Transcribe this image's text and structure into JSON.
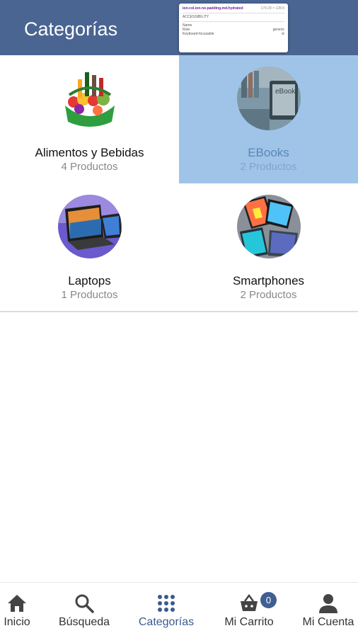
{
  "header": {
    "title": "Categorías"
  },
  "inspector_tooltip": {
    "selector": "ion-col.ion-no-padding.md.hydrated",
    "size": "179.29 × 128.5",
    "section": "ACCESSIBILITY",
    "rows": [
      {
        "label": "Name",
        "value": ""
      },
      {
        "label": "Role",
        "value": "generic"
      },
      {
        "label": "Keyboard-focusable",
        "value": "⊘"
      }
    ]
  },
  "categories": [
    {
      "name": "Alimentos y Bebidas",
      "count": "4 Productos",
      "icon": "groceries-basket-image"
    },
    {
      "name": "EBooks",
      "count": "2 Productos",
      "icon": "ebook-reader-image"
    },
    {
      "name": "Laptops",
      "count": "1 Productos",
      "icon": "laptop-image"
    },
    {
      "name": "Smartphones",
      "count": "2 Productos",
      "icon": "smartphones-image"
    }
  ],
  "bottom_nav": {
    "items": [
      {
        "label": "Inicio",
        "icon": "home-icon"
      },
      {
        "label": "Búsqueda",
        "icon": "search-icon"
      },
      {
        "label": "Categorías",
        "icon": "grid-icon"
      },
      {
        "label": "Mi Carrito",
        "icon": "cart-icon",
        "badge": "0"
      },
      {
        "label": "Mi Cuenta",
        "icon": "person-icon"
      }
    ],
    "active": "Categorías"
  },
  "colors": {
    "header": "#4a6592",
    "highlight": "#9fc4e8",
    "active_nav": "#3b5a8e"
  }
}
